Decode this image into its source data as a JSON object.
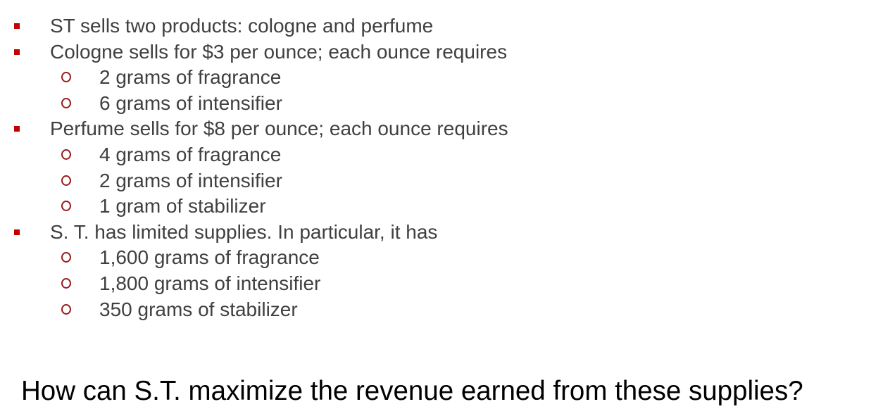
{
  "bullets": [
    {
      "level": 1,
      "text": "ST sells two products: cologne and perfume"
    },
    {
      "level": 1,
      "text": "Cologne sells for $3 per ounce; each ounce requires"
    },
    {
      "level": 2,
      "text": "2 grams of fragrance"
    },
    {
      "level": 2,
      "text": "6 grams of intensifier"
    },
    {
      "level": 1,
      "text": "Perfume sells for $8 per ounce; each ounce requires"
    },
    {
      "level": 2,
      "text": "4 grams of fragrance"
    },
    {
      "level": 2,
      "text": "2 grams of intensifier"
    },
    {
      "level": 2,
      "text": "1 gram of stabilizer"
    },
    {
      "level": 1,
      "text": "S. T. has limited supplies. In particular, it has"
    },
    {
      "level": 2,
      "text": "1,600 grams of fragrance"
    },
    {
      "level": 2,
      "text": "1,800 grams of intensifier"
    },
    {
      "level": 2,
      "text": "350 grams of stabilizer"
    }
  ],
  "question": "How can S.T. maximize the revenue earned from these supplies?",
  "colors": {
    "bullet_square": "#c00000",
    "bullet_circle": "#9b1c1c",
    "body_text": "#404040",
    "question_text": "#000000"
  }
}
